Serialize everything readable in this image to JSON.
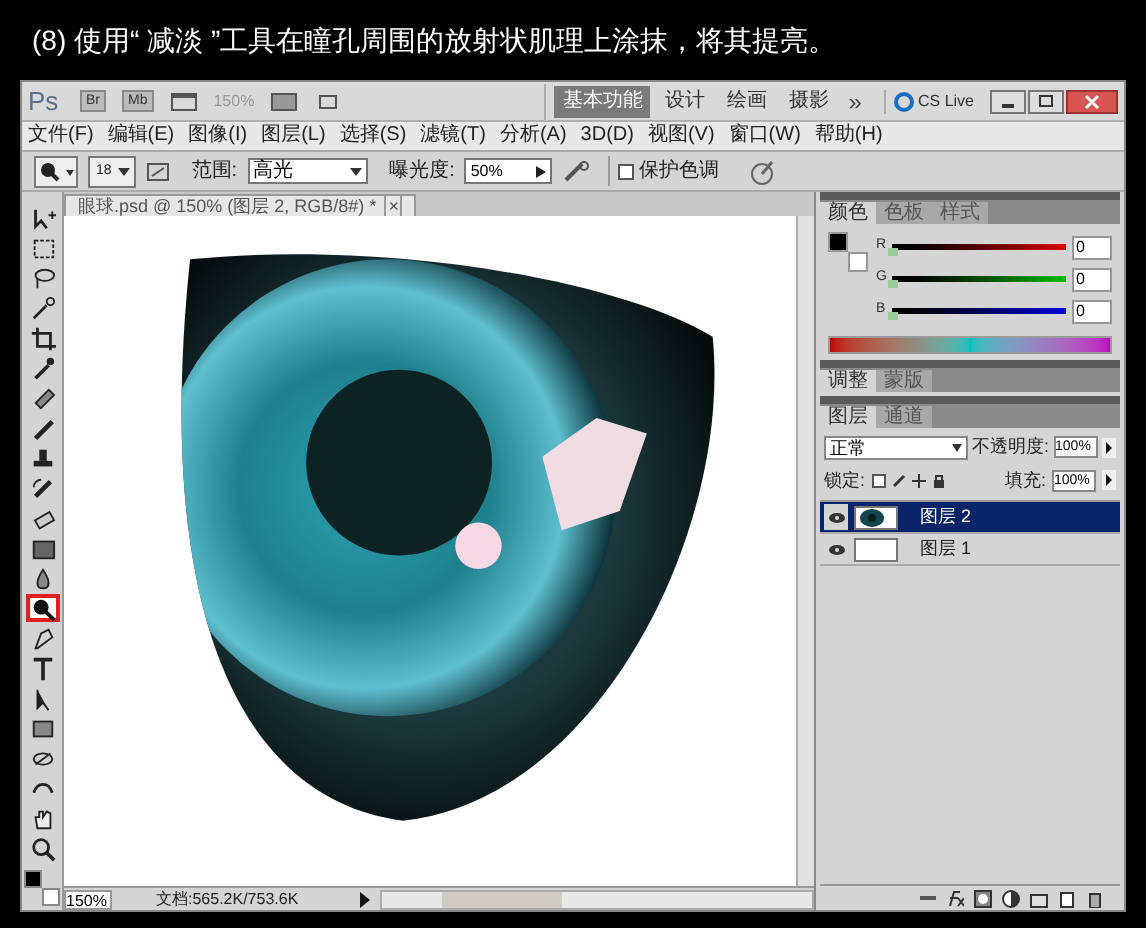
{
  "caption": "(8) 使用“ 减淡 ”工具在瞳孔周围的放射状肌理上涂抹，将其提亮。",
  "app_bar": {
    "logo": "Ps",
    "launchers": [
      "Br",
      "Mb"
    ],
    "zoom": "150%",
    "workspaces": [
      {
        "label": "基本功能",
        "selected": true
      },
      {
        "label": "设计",
        "selected": false
      },
      {
        "label": "绘画",
        "selected": false
      },
      {
        "label": "摄影",
        "selected": false
      }
    ],
    "more": "»",
    "cs_live": "CS Live"
  },
  "menu": [
    "文件(F)",
    "编辑(E)",
    "图像(I)",
    "图层(L)",
    "选择(S)",
    "滤镜(T)",
    "分析(A)",
    "3D(D)",
    "视图(V)",
    "窗口(W)",
    "帮助(H)"
  ],
  "options": {
    "brush_size": "18",
    "range_label": "范围:",
    "range_value": "高光",
    "exposure_label": "曝光度:",
    "exposure_value": "50%",
    "protect_tones": {
      "label": "保护色调",
      "checked": false
    }
  },
  "tools": [
    {
      "kind": "move",
      "selected": false
    },
    {
      "kind": "marquee",
      "selected": false
    },
    {
      "kind": "lasso",
      "selected": false
    },
    {
      "kind": "wand",
      "selected": false
    },
    {
      "kind": "crop",
      "selected": false
    },
    {
      "kind": "eyedropper",
      "selected": false
    },
    {
      "kind": "healing",
      "selected": false
    },
    {
      "kind": "brush",
      "selected": false
    },
    {
      "kind": "stamp",
      "selected": false
    },
    {
      "kind": "history",
      "selected": false
    },
    {
      "kind": "eraser",
      "selected": false
    },
    {
      "kind": "gradient",
      "selected": false
    },
    {
      "kind": "blur",
      "selected": false
    },
    {
      "kind": "dodge",
      "selected": true
    },
    {
      "kind": "pen",
      "selected": false
    },
    {
      "kind": "type",
      "selected": false
    },
    {
      "kind": "path",
      "selected": false
    },
    {
      "kind": "shape",
      "selected": false
    },
    {
      "kind": "rotate3d",
      "selected": false
    },
    {
      "kind": "orbit3d",
      "selected": false
    },
    {
      "kind": "hand",
      "selected": false
    },
    {
      "kind": "zoom",
      "selected": false
    }
  ],
  "document": {
    "tab": "眼球.psd @ 150% (图层 2, RGB/8#) *",
    "close": "×",
    "zoom": "150%",
    "status": "文档:565.2K/753.6K"
  },
  "color_panel": {
    "tabs": [
      {
        "label": "颜色",
        "selected": true
      },
      {
        "label": "色板",
        "selected": false
      },
      {
        "label": "样式",
        "selected": false
      }
    ],
    "channels": [
      {
        "name": "R",
        "value": "0",
        "level": 0
      },
      {
        "name": "G",
        "value": "0",
        "level": 0
      },
      {
        "name": "B",
        "value": "0",
        "level": 0
      }
    ]
  },
  "adjust_panel": {
    "tabs": [
      {
        "label": "调整",
        "selected": true
      },
      {
        "label": "蒙版",
        "selected": false
      }
    ]
  },
  "layers_panel": {
    "tabs": [
      {
        "label": "图层",
        "selected": true
      },
      {
        "label": "通道",
        "selected": false
      }
    ],
    "blend_mode": "正常",
    "opacity_label": "不透明度:",
    "opacity": "100%",
    "lock_label": "锁定:",
    "fill_label": "填充:",
    "fill": "100%",
    "layers": [
      {
        "name": "图层 2",
        "selected": true,
        "visible": true,
        "kind": "eye"
      },
      {
        "name": "图层 1",
        "selected": false,
        "visible": true,
        "kind": "blank"
      }
    ]
  }
}
